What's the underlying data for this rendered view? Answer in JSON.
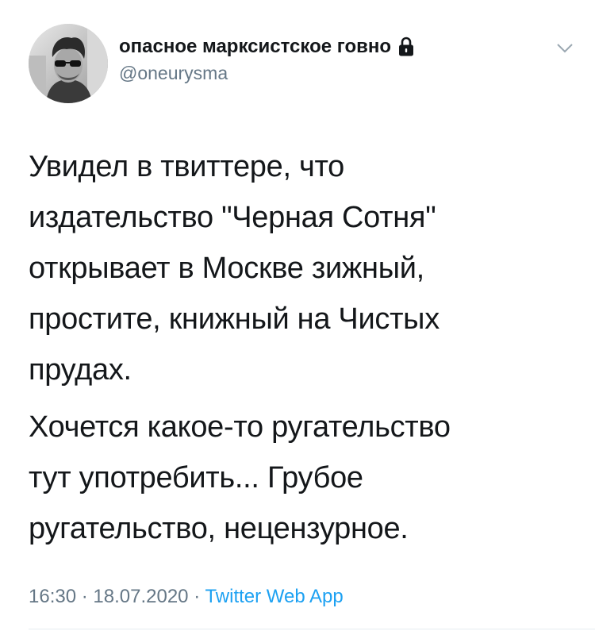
{
  "tweet": {
    "author": {
      "display_name": "опасное марксистское говно",
      "handle": "@oneurysma",
      "protected_icon": "lock-icon"
    },
    "menu_icon": "chevron-down-icon",
    "body": {
      "paragraph1": [
        "Увидел в твиттере, что",
        "издательство \"Черная Сотня\"",
        "открывает в Москве зижный,",
        "простите, книжный на Чистых",
        "прудах."
      ],
      "paragraph2": [
        "Хочется какое-то ругательство",
        "тут употребить... Грубое",
        "ругательство, нецензурное."
      ]
    },
    "meta": {
      "time": "16:30",
      "separator": "·",
      "date": "18.07.2020",
      "source": "Twitter Web App"
    }
  },
  "colors": {
    "text": "#14171a",
    "secondary": "#657786",
    "link": "#1da1f2",
    "divider": "#e6ecf0"
  }
}
